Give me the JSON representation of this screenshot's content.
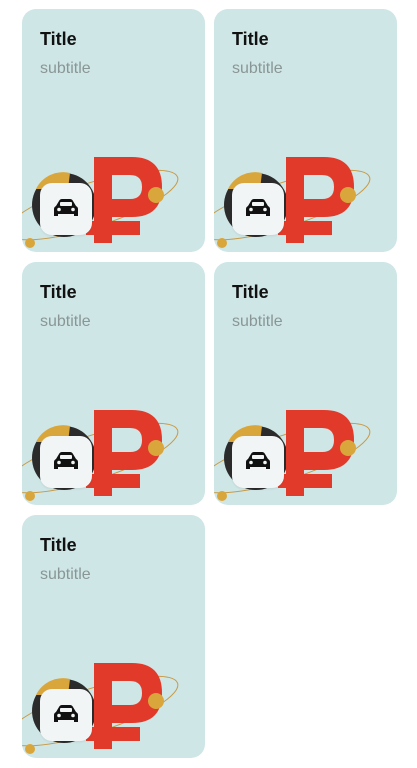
{
  "cards": [
    {
      "title": "Title",
      "subtitle": "subtitle",
      "icon": "car-icon"
    },
    {
      "title": "Title",
      "subtitle": "subtitle",
      "icon": "car-icon"
    },
    {
      "title": "Title",
      "subtitle": "subtitle",
      "icon": "car-icon"
    },
    {
      "title": "Title",
      "subtitle": "subtitle",
      "icon": "car-icon"
    },
    {
      "title": "Title",
      "subtitle": "subtitle",
      "icon": "car-icon"
    }
  ],
  "colors": {
    "card_background": "#cfe6e6",
    "ruble_sign": "#e23a2a",
    "gold_sphere": "#d9a63c",
    "coin_dark": "#2b2b2b",
    "icon_tile": "#f2f5f6",
    "subtitle_text": "#8a9696"
  }
}
